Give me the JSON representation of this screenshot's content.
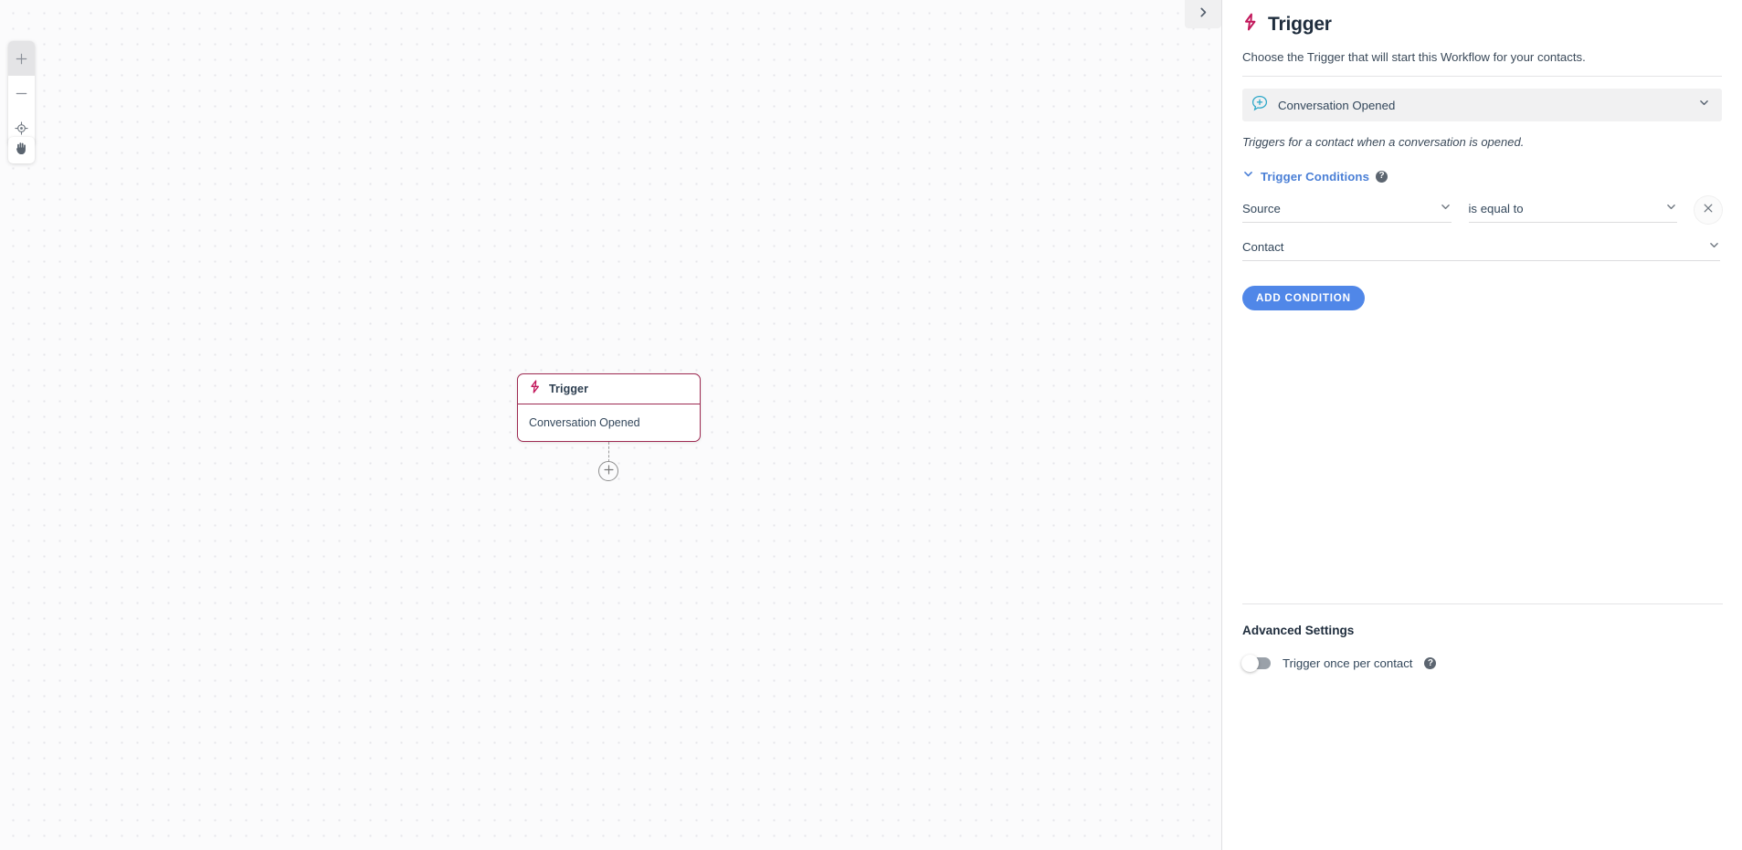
{
  "canvas": {
    "toolbar": {
      "zoom_in_icon": "plus-icon",
      "zoom_out_icon": "minus-icon",
      "fit_view_icon": "crosshair-target-icon",
      "pan_icon": "hand-icon"
    },
    "panel_toggle_icon": "chevron-right-icon",
    "node": {
      "icon": "lightning-bolt-icon",
      "title": "Trigger",
      "body": "Conversation Opened",
      "border_color": "#9e2a52"
    },
    "add_node_icon": "plus-circle-icon"
  },
  "panel": {
    "icon": "lightning-bolt-icon",
    "title": "Trigger",
    "subtitle": "Choose the Trigger that will start this Workflow for your contacts.",
    "trigger_select": {
      "icon": "chat-bubble-plus-icon",
      "icon_color": "#2aa7c8",
      "value": "Conversation Opened",
      "chevron_icon": "chevron-down-icon"
    },
    "trigger_description": "Triggers for a contact when a conversation is opened.",
    "conditions": {
      "collapse_icon": "chevron-down-icon",
      "label": "Trigger Conditions",
      "help_icon": "question-mark-icon",
      "help_glyph": "?",
      "rows": [
        {
          "field": {
            "name": "source-select",
            "value": "Source",
            "chevron_icon": "chevron-down-icon"
          },
          "operator": {
            "name": "operator-select",
            "value": "is equal to",
            "chevron_icon": "chevron-down-icon"
          },
          "delete_icon": "close-x-icon"
        },
        {
          "field": {
            "name": "contact-select",
            "value": "Contact",
            "chevron_icon": "chevron-down-icon"
          }
        }
      ],
      "add_button_label": "ADD CONDITION",
      "add_button_color": "#5087e8"
    },
    "advanced": {
      "title": "Advanced Settings",
      "toggle": {
        "label": "Trigger once per contact",
        "state": "off",
        "help_icon": "question-mark-icon",
        "help_glyph": "?"
      }
    }
  },
  "colors": {
    "accent_blue": "#4a7fd6",
    "brand_crimson": "#9e2a52",
    "teal": "#2aa7c8",
    "canvas_bg": "#fbfbfc"
  }
}
